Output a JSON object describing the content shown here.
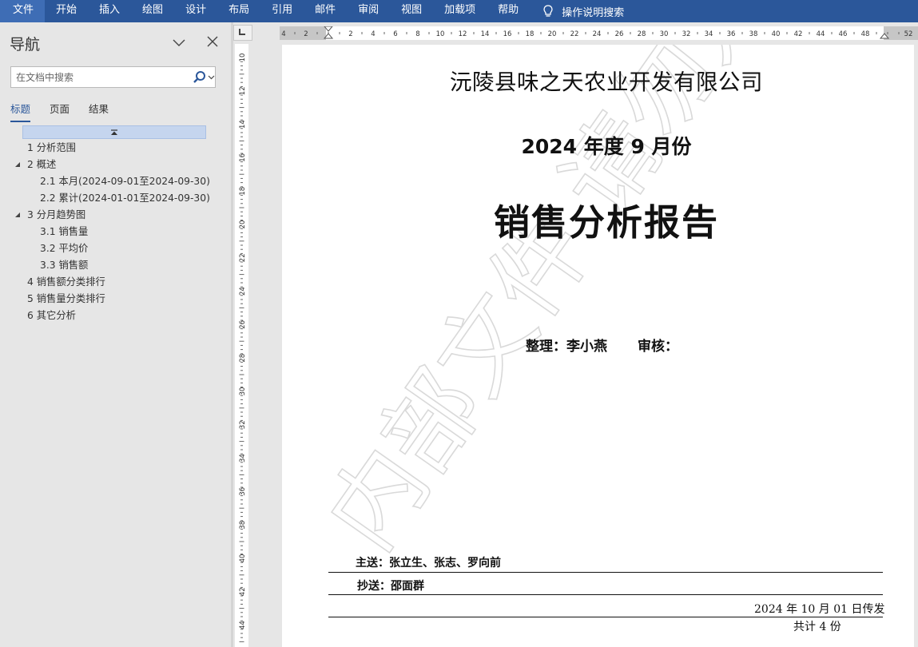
{
  "menu": {
    "items": [
      "文件",
      "开始",
      "插入",
      "绘图",
      "设计",
      "布局",
      "引用",
      "邮件",
      "审阅",
      "视图",
      "加载项",
      "帮助"
    ],
    "tell_me": "操作说明搜索"
  },
  "nav": {
    "title": "导航",
    "search_placeholder": "在文档中搜索",
    "tabs": [
      "标题",
      "页面",
      "结果"
    ],
    "active_tab": "标题",
    "outline": [
      {
        "text": "1 分析范围",
        "level": 1,
        "expandable": false
      },
      {
        "text": "2 概述",
        "level": 1,
        "expandable": true
      },
      {
        "text": "2.1 本月(2024-09-01至2024-09-30)",
        "level": 2,
        "expandable": false
      },
      {
        "text": "2.2 累计(2024-01-01至2024-09-30)",
        "level": 2,
        "expandable": false
      },
      {
        "text": "3 分月趋势图",
        "level": 1,
        "expandable": true
      },
      {
        "text": "3.1 销售量",
        "level": 2,
        "expandable": false
      },
      {
        "text": "3.2 平均价",
        "level": 2,
        "expandable": false
      },
      {
        "text": "3.3 销售额",
        "level": 2,
        "expandable": false
      },
      {
        "text": "4 销售额分类排行",
        "level": 1,
        "expandable": false
      },
      {
        "text": "5 销售量分类排行",
        "level": 1,
        "expandable": false
      },
      {
        "text": "6 其它分析",
        "level": 1,
        "expandable": false
      }
    ]
  },
  "ruler": {
    "h_labels": [
      "4",
      "2",
      "2",
      "4",
      "6",
      "8",
      "10",
      "12",
      "14",
      "16",
      "18",
      "20",
      "22",
      "24",
      "26",
      "28",
      "30",
      "32",
      "34",
      "36",
      "38",
      "40",
      "42",
      "44",
      "46",
      "48",
      "52"
    ],
    "v_labels": [
      "10",
      "12",
      "14",
      "16",
      "18",
      "20",
      "22",
      "24",
      "26",
      "28",
      "30",
      "32",
      "34",
      "36",
      "38",
      "40",
      "42",
      "44"
    ]
  },
  "document": {
    "company": "沅陵县味之天农业开发有限公司",
    "period": "2024 年度 9 月份",
    "title": "销售分析报告",
    "prepared_by": "整理：李小燕",
    "reviewed_by": "审核：",
    "send_to": "主送：张立生、张志、罗向前",
    "copy_to": "抄送：邵面群",
    "issue_date": "2024 年 10 月 01 日传发",
    "copies": "共计 4 份",
    "watermark": "内部文件 请勿外传"
  },
  "colors": {
    "ribbon": "#2b579a",
    "nav_bg": "#e6e6e6",
    "highlight": "#c5d5ee"
  }
}
